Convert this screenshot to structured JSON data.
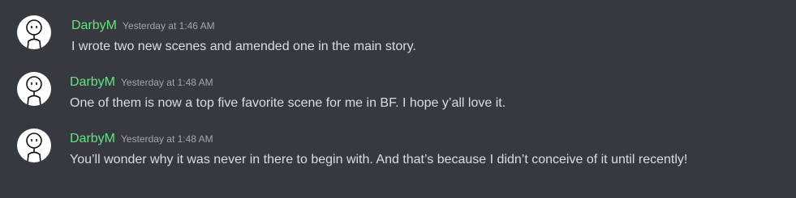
{
  "messages": [
    {
      "author": "DarbyM",
      "timestamp": "Yesterday at 1:46 AM",
      "text": "I wrote two new scenes and amended one in the main story.",
      "avatar_icon": "stick-figure-avatar-icon"
    },
    {
      "author": "DarbyM",
      "timestamp": "Yesterday at 1:48 AM",
      "text": "One of them is now a top five favorite scene for me in BF. I hope y’all love it.",
      "avatar_icon": "stick-figure-avatar-icon"
    },
    {
      "author": "DarbyM",
      "timestamp": "Yesterday at 1:48 AM",
      "text": "You’ll wonder why it was never in there to begin with. And that’s because I didn’t conceive of it until recently!",
      "avatar_icon": "stick-figure-avatar-icon"
    }
  ],
  "colors": {
    "background": "#36393f",
    "username": "#67e282",
    "timestamp": "#a3a6aa",
    "message_text": "#dcddde",
    "avatar_bg": "#ffffff"
  }
}
